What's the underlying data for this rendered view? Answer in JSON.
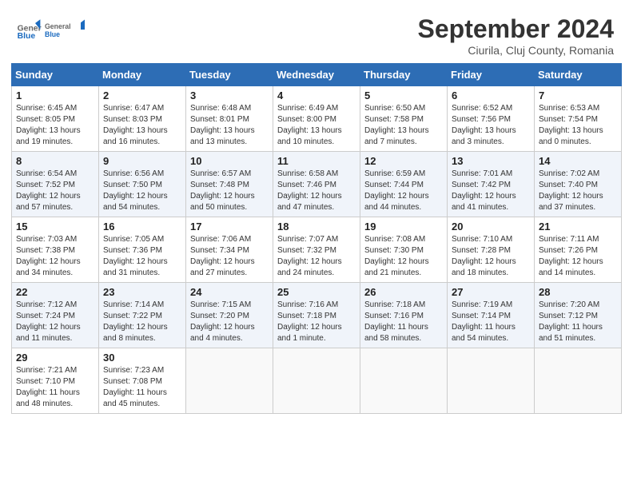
{
  "header": {
    "logo_general": "General",
    "logo_blue": "Blue",
    "month_title": "September 2024",
    "subtitle": "Ciurila, Cluj County, Romania"
  },
  "weekdays": [
    "Sunday",
    "Monday",
    "Tuesday",
    "Wednesday",
    "Thursday",
    "Friday",
    "Saturday"
  ],
  "weeks": [
    [
      {
        "day": "1",
        "sunrise": "Sunrise: 6:45 AM",
        "sunset": "Sunset: 8:05 PM",
        "daylight": "Daylight: 13 hours and 19 minutes."
      },
      {
        "day": "2",
        "sunrise": "Sunrise: 6:47 AM",
        "sunset": "Sunset: 8:03 PM",
        "daylight": "Daylight: 13 hours and 16 minutes."
      },
      {
        "day": "3",
        "sunrise": "Sunrise: 6:48 AM",
        "sunset": "Sunset: 8:01 PM",
        "daylight": "Daylight: 13 hours and 13 minutes."
      },
      {
        "day": "4",
        "sunrise": "Sunrise: 6:49 AM",
        "sunset": "Sunset: 8:00 PM",
        "daylight": "Daylight: 13 hours and 10 minutes."
      },
      {
        "day": "5",
        "sunrise": "Sunrise: 6:50 AM",
        "sunset": "Sunset: 7:58 PM",
        "daylight": "Daylight: 13 hours and 7 minutes."
      },
      {
        "day": "6",
        "sunrise": "Sunrise: 6:52 AM",
        "sunset": "Sunset: 7:56 PM",
        "daylight": "Daylight: 13 hours and 3 minutes."
      },
      {
        "day": "7",
        "sunrise": "Sunrise: 6:53 AM",
        "sunset": "Sunset: 7:54 PM",
        "daylight": "Daylight: 13 hours and 0 minutes."
      }
    ],
    [
      {
        "day": "8",
        "sunrise": "Sunrise: 6:54 AM",
        "sunset": "Sunset: 7:52 PM",
        "daylight": "Daylight: 12 hours and 57 minutes."
      },
      {
        "day": "9",
        "sunrise": "Sunrise: 6:56 AM",
        "sunset": "Sunset: 7:50 PM",
        "daylight": "Daylight: 12 hours and 54 minutes."
      },
      {
        "day": "10",
        "sunrise": "Sunrise: 6:57 AM",
        "sunset": "Sunset: 7:48 PM",
        "daylight": "Daylight: 12 hours and 50 minutes."
      },
      {
        "day": "11",
        "sunrise": "Sunrise: 6:58 AM",
        "sunset": "Sunset: 7:46 PM",
        "daylight": "Daylight: 12 hours and 47 minutes."
      },
      {
        "day": "12",
        "sunrise": "Sunrise: 6:59 AM",
        "sunset": "Sunset: 7:44 PM",
        "daylight": "Daylight: 12 hours and 44 minutes."
      },
      {
        "day": "13",
        "sunrise": "Sunrise: 7:01 AM",
        "sunset": "Sunset: 7:42 PM",
        "daylight": "Daylight: 12 hours and 41 minutes."
      },
      {
        "day": "14",
        "sunrise": "Sunrise: 7:02 AM",
        "sunset": "Sunset: 7:40 PM",
        "daylight": "Daylight: 12 hours and 37 minutes."
      }
    ],
    [
      {
        "day": "15",
        "sunrise": "Sunrise: 7:03 AM",
        "sunset": "Sunset: 7:38 PM",
        "daylight": "Daylight: 12 hours and 34 minutes."
      },
      {
        "day": "16",
        "sunrise": "Sunrise: 7:05 AM",
        "sunset": "Sunset: 7:36 PM",
        "daylight": "Daylight: 12 hours and 31 minutes."
      },
      {
        "day": "17",
        "sunrise": "Sunrise: 7:06 AM",
        "sunset": "Sunset: 7:34 PM",
        "daylight": "Daylight: 12 hours and 27 minutes."
      },
      {
        "day": "18",
        "sunrise": "Sunrise: 7:07 AM",
        "sunset": "Sunset: 7:32 PM",
        "daylight": "Daylight: 12 hours and 24 minutes."
      },
      {
        "day": "19",
        "sunrise": "Sunrise: 7:08 AM",
        "sunset": "Sunset: 7:30 PM",
        "daylight": "Daylight: 12 hours and 21 minutes."
      },
      {
        "day": "20",
        "sunrise": "Sunrise: 7:10 AM",
        "sunset": "Sunset: 7:28 PM",
        "daylight": "Daylight: 12 hours and 18 minutes."
      },
      {
        "day": "21",
        "sunrise": "Sunrise: 7:11 AM",
        "sunset": "Sunset: 7:26 PM",
        "daylight": "Daylight: 12 hours and 14 minutes."
      }
    ],
    [
      {
        "day": "22",
        "sunrise": "Sunrise: 7:12 AM",
        "sunset": "Sunset: 7:24 PM",
        "daylight": "Daylight: 12 hours and 11 minutes."
      },
      {
        "day": "23",
        "sunrise": "Sunrise: 7:14 AM",
        "sunset": "Sunset: 7:22 PM",
        "daylight": "Daylight: 12 hours and 8 minutes."
      },
      {
        "day": "24",
        "sunrise": "Sunrise: 7:15 AM",
        "sunset": "Sunset: 7:20 PM",
        "daylight": "Daylight: 12 hours and 4 minutes."
      },
      {
        "day": "25",
        "sunrise": "Sunrise: 7:16 AM",
        "sunset": "Sunset: 7:18 PM",
        "daylight": "Daylight: 12 hours and 1 minute."
      },
      {
        "day": "26",
        "sunrise": "Sunrise: 7:18 AM",
        "sunset": "Sunset: 7:16 PM",
        "daylight": "Daylight: 11 hours and 58 minutes."
      },
      {
        "day": "27",
        "sunrise": "Sunrise: 7:19 AM",
        "sunset": "Sunset: 7:14 PM",
        "daylight": "Daylight: 11 hours and 54 minutes."
      },
      {
        "day": "28",
        "sunrise": "Sunrise: 7:20 AM",
        "sunset": "Sunset: 7:12 PM",
        "daylight": "Daylight: 11 hours and 51 minutes."
      }
    ],
    [
      {
        "day": "29",
        "sunrise": "Sunrise: 7:21 AM",
        "sunset": "Sunset: 7:10 PM",
        "daylight": "Daylight: 11 hours and 48 minutes."
      },
      {
        "day": "30",
        "sunrise": "Sunrise: 7:23 AM",
        "sunset": "Sunset: 7:08 PM",
        "daylight": "Daylight: 11 hours and 45 minutes."
      },
      null,
      null,
      null,
      null,
      null
    ]
  ]
}
